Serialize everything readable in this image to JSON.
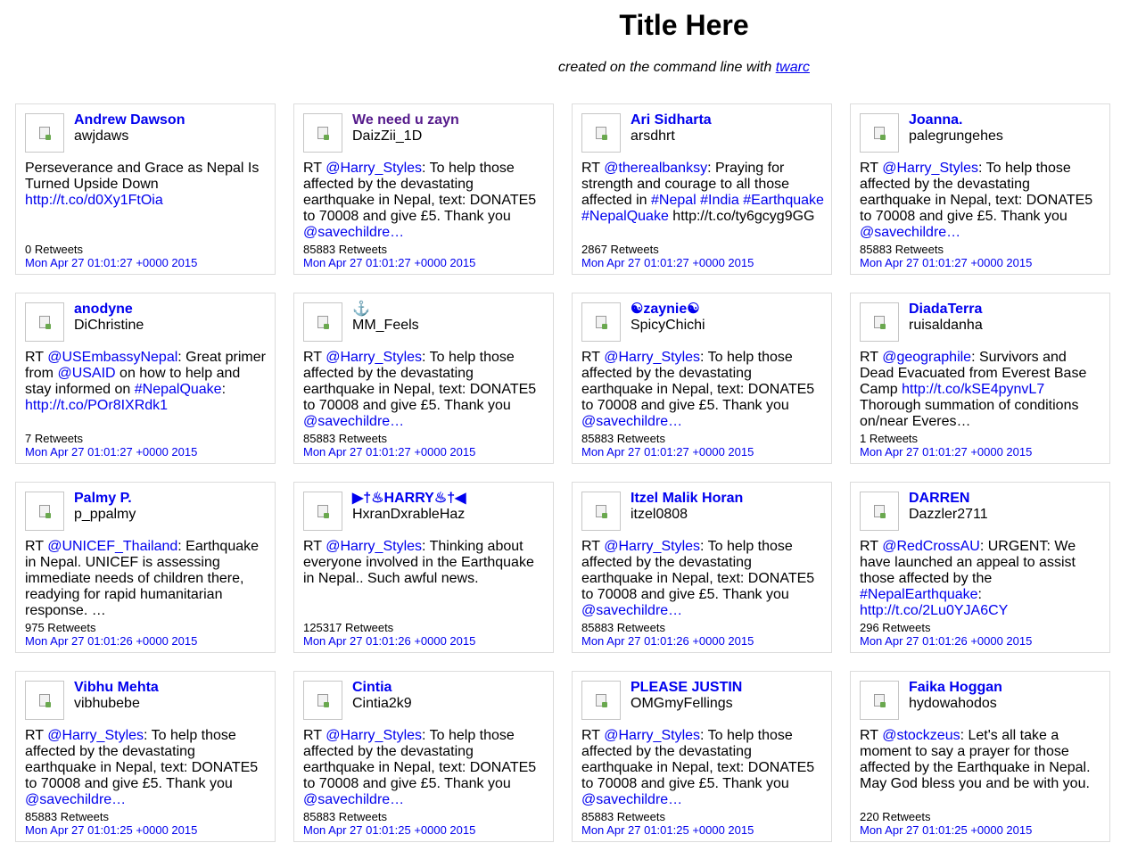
{
  "page": {
    "title": "Title Here",
    "subtitle_prefix": "created on the command line with ",
    "subtitle_link": "twarc"
  },
  "tweets": [
    {
      "name": "Andrew Dawson",
      "handle": "awjdaws",
      "text": [
        {
          "t": "Perseverance and Grace as Nepal Is Turned Upside Down "
        },
        {
          "t": "http://t.co/d0Xy1FtOia",
          "link": true
        }
      ],
      "retweets": "0 Retweets",
      "date": "Mon Apr 27 01:01:27 +0000 2015"
    },
    {
      "name": "We need u zayn",
      "handle": "DaizZii_1D",
      "visited": true,
      "text": [
        {
          "t": "RT "
        },
        {
          "t": "@Harry_Styles",
          "link": true
        },
        {
          "t": ": To help those affected by the devastating earthquake in Nepal, text: DONATE5 to 70008 and give £5. Thank you "
        },
        {
          "t": "@savechildre…",
          "link": true
        }
      ],
      "retweets": "85883 Retweets",
      "date": "Mon Apr 27 01:01:27 +0000 2015"
    },
    {
      "name": "Ari Sidharta",
      "handle": "arsdhrt",
      "text": [
        {
          "t": "RT "
        },
        {
          "t": "@therealbanksy",
          "link": true
        },
        {
          "t": ": Praying for strength and courage to all those affected in "
        },
        {
          "t": "#Nepal",
          "link": true
        },
        {
          "t": " "
        },
        {
          "t": "#India",
          "link": true
        },
        {
          "t": " "
        },
        {
          "t": "#Earthquake",
          "link": true
        },
        {
          "t": " "
        },
        {
          "t": "#NepalQuake",
          "link": true
        },
        {
          "t": " http://t.co/ty6gcyg9GG"
        }
      ],
      "retweets": "2867 Retweets",
      "date": "Mon Apr 27 01:01:27 +0000 2015"
    },
    {
      "name": "Joanna.",
      "handle": "palegrungehes",
      "text": [
        {
          "t": "RT "
        },
        {
          "t": "@Harry_Styles",
          "link": true
        },
        {
          "t": ": To help those affected by the devastating earthquake in Nepal, text: DONATE5 to 70008 and give £5. Thank you "
        },
        {
          "t": "@savechildre…",
          "link": true
        }
      ],
      "retweets": "85883 Retweets",
      "date": "Mon Apr 27 01:01:27 +0000 2015"
    },
    {
      "name": "anodyne",
      "handle": "DiChristine",
      "text": [
        {
          "t": "RT "
        },
        {
          "t": "@USEmbassyNepal",
          "link": true
        },
        {
          "t": ": Great primer from "
        },
        {
          "t": "@USAID",
          "link": true
        },
        {
          "t": " on how to help and stay informed on "
        },
        {
          "t": "#NepalQuake",
          "link": true
        },
        {
          "t": ": "
        },
        {
          "t": "http://t.co/POr8IXRdk1",
          "link": true
        }
      ],
      "retweets": "7 Retweets",
      "date": "Mon Apr 27 01:01:27 +0000 2015"
    },
    {
      "name": "⚓",
      "handle": "MM_Feels",
      "text": [
        {
          "t": "RT "
        },
        {
          "t": "@Harry_Styles",
          "link": true
        },
        {
          "t": ": To help those affected by the devastating earthquake in Nepal, text: DONATE5 to 70008 and give £5. Thank you "
        },
        {
          "t": "@savechildre…",
          "link": true
        }
      ],
      "retweets": "85883 Retweets",
      "date": "Mon Apr 27 01:01:27 +0000 2015"
    },
    {
      "name": "☯zaynie☯",
      "handle": "SpicyChichi",
      "text": [
        {
          "t": "RT "
        },
        {
          "t": "@Harry_Styles",
          "link": true
        },
        {
          "t": ": To help those affected by the devastating earthquake in Nepal, text: DONATE5 to 70008 and give £5. Thank you "
        },
        {
          "t": "@savechildre…",
          "link": true
        }
      ],
      "retweets": "85883 Retweets",
      "date": "Mon Apr 27 01:01:27 +0000 2015"
    },
    {
      "name": "DiadaTerra",
      "handle": "ruisaldanha",
      "text": [
        {
          "t": "RT "
        },
        {
          "t": "@geographile",
          "link": true
        },
        {
          "t": ": Survivors and Dead Evacuated from Everest Base Camp "
        },
        {
          "t": "http://t.co/kSE4pynvL7",
          "link": true
        },
        {
          "t": " Thorough summation of conditions on/near Everes…"
        }
      ],
      "retweets": "1 Retweets",
      "date": "Mon Apr 27 01:01:27 +0000 2015"
    },
    {
      "name": "Palmy P.",
      "handle": "p_ppalmy",
      "text": [
        {
          "t": "RT "
        },
        {
          "t": "@UNICEF_Thailand",
          "link": true
        },
        {
          "t": ": Earthquake in Nepal. UNICEF is assessing immediate needs of children there, readying for rapid humanitarian response. …"
        }
      ],
      "retweets": "975 Retweets",
      "date": "Mon Apr 27 01:01:26 +0000 2015"
    },
    {
      "name": "▶†♨HARRY♨†◀",
      "handle": "HxranDxrableHaz",
      "text": [
        {
          "t": "RT "
        },
        {
          "t": "@Harry_Styles",
          "link": true
        },
        {
          "t": ": Thinking about everyone involved in the Earthquake in Nepal.. Such awful news."
        }
      ],
      "retweets": "125317 Retweets",
      "date": "Mon Apr 27 01:01:26 +0000 2015"
    },
    {
      "name": "Itzel Malik Horan",
      "handle": "itzel0808",
      "text": [
        {
          "t": "RT "
        },
        {
          "t": "@Harry_Styles",
          "link": true
        },
        {
          "t": ": To help those affected by the devastating earthquake in Nepal, text: DONATE5 to 70008 and give £5. Thank you "
        },
        {
          "t": "@savechildre…",
          "link": true
        }
      ],
      "retweets": "85883 Retweets",
      "date": "Mon Apr 27 01:01:26 +0000 2015"
    },
    {
      "name": "DARREN",
      "handle": "Dazzler2711",
      "text": [
        {
          "t": "RT "
        },
        {
          "t": "@RedCrossAU",
          "link": true
        },
        {
          "t": ": URGENT: We have launched an appeal to assist those affected by the "
        },
        {
          "t": "#NepalEarthquake",
          "link": true
        },
        {
          "t": ": "
        },
        {
          "t": "http://t.co/2Lu0YJA6CY",
          "link": true
        }
      ],
      "retweets": "296 Retweets",
      "date": "Mon Apr 27 01:01:26 +0000 2015"
    },
    {
      "name": "Vibhu Mehta",
      "handle": "vibhubebe",
      "text": [
        {
          "t": "RT "
        },
        {
          "t": "@Harry_Styles",
          "link": true
        },
        {
          "t": ": To help those affected by the devastating earthquake in Nepal, text: DONATE5 to 70008 and give £5. Thank you "
        },
        {
          "t": "@savechildre…",
          "link": true
        }
      ],
      "retweets": "85883 Retweets",
      "date": "Mon Apr 27 01:01:25 +0000 2015"
    },
    {
      "name": "Cintia",
      "handle": "Cintia2k9",
      "text": [
        {
          "t": "RT "
        },
        {
          "t": "@Harry_Styles",
          "link": true
        },
        {
          "t": ": To help those affected by the devastating earthquake in Nepal, text: DONATE5 to 70008 and give £5. Thank you "
        },
        {
          "t": "@savechildre…",
          "link": true
        }
      ],
      "retweets": "85883 Retweets",
      "date": "Mon Apr 27 01:01:25 +0000 2015"
    },
    {
      "name": "PLEASE JUSTIN",
      "handle": "OMGmyFellings",
      "text": [
        {
          "t": "RT "
        },
        {
          "t": "@Harry_Styles",
          "link": true
        },
        {
          "t": ": To help those affected by the devastating earthquake in Nepal, text: DONATE5 to 70008 and give £5. Thank you "
        },
        {
          "t": "@savechildre…",
          "link": true
        }
      ],
      "retweets": "85883 Retweets",
      "date": "Mon Apr 27 01:01:25 +0000 2015"
    },
    {
      "name": "Faika Hoggan",
      "handle": "hydowahodos",
      "text": [
        {
          "t": "RT "
        },
        {
          "t": "@stockzeus",
          "link": true
        },
        {
          "t": ": Let's all take a moment to say a prayer for those affected by the Earthquake in Nepal. May God bless you and be with you."
        }
      ],
      "retweets": "220 Retweets",
      "date": "Mon Apr 27 01:01:25 +0000 2015"
    }
  ]
}
